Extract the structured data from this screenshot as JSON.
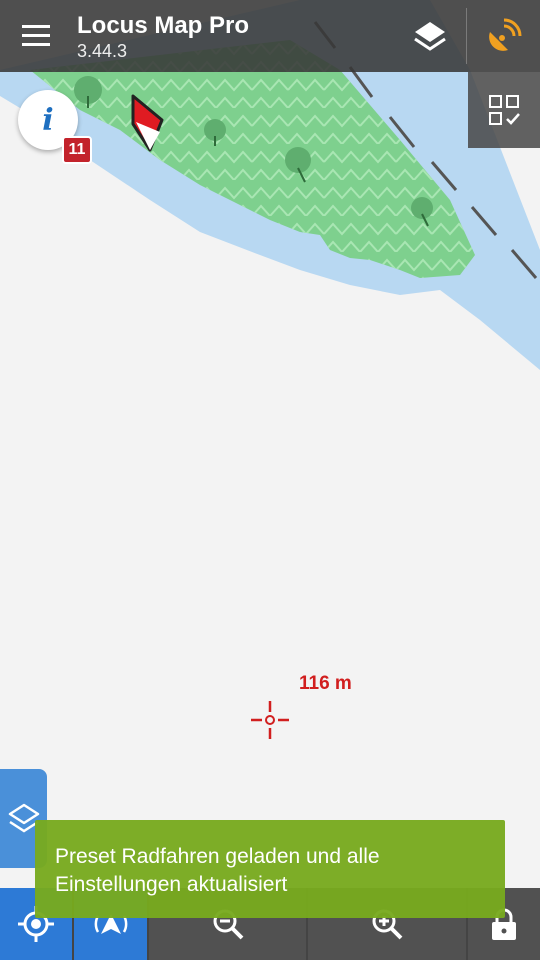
{
  "app": {
    "title": "Locus Map Pro",
    "version": "3.44.3"
  },
  "icons": {
    "menu": "hamburger-menu-icon",
    "layers": "layers-icon",
    "gps": "satellite-gps-icon",
    "grid": "dashboard-grid-icon",
    "info": "info-icon",
    "my_location": "my-location-icon",
    "guidance": "guidance-arrow-icon",
    "zoom_out": "zoom-out-icon",
    "zoom_in": "zoom-in-icon",
    "lock": "lock-icon"
  },
  "info": {
    "label": "i",
    "badge_count": "11"
  },
  "map": {
    "scale_label": "116 m"
  },
  "toast": {
    "line1": "Preset Radfahren geladen und alle",
    "line2": "Einstellungen aktualisiert"
  },
  "colors": {
    "accent_blue": "#1e6fc0",
    "gps_orange": "#f0a020",
    "badge_red": "#c3232b",
    "toast_green": "#78aa1e",
    "water": "#b8d8f2",
    "forest": "#7ed08e",
    "scale_red": "#d11e1e"
  }
}
